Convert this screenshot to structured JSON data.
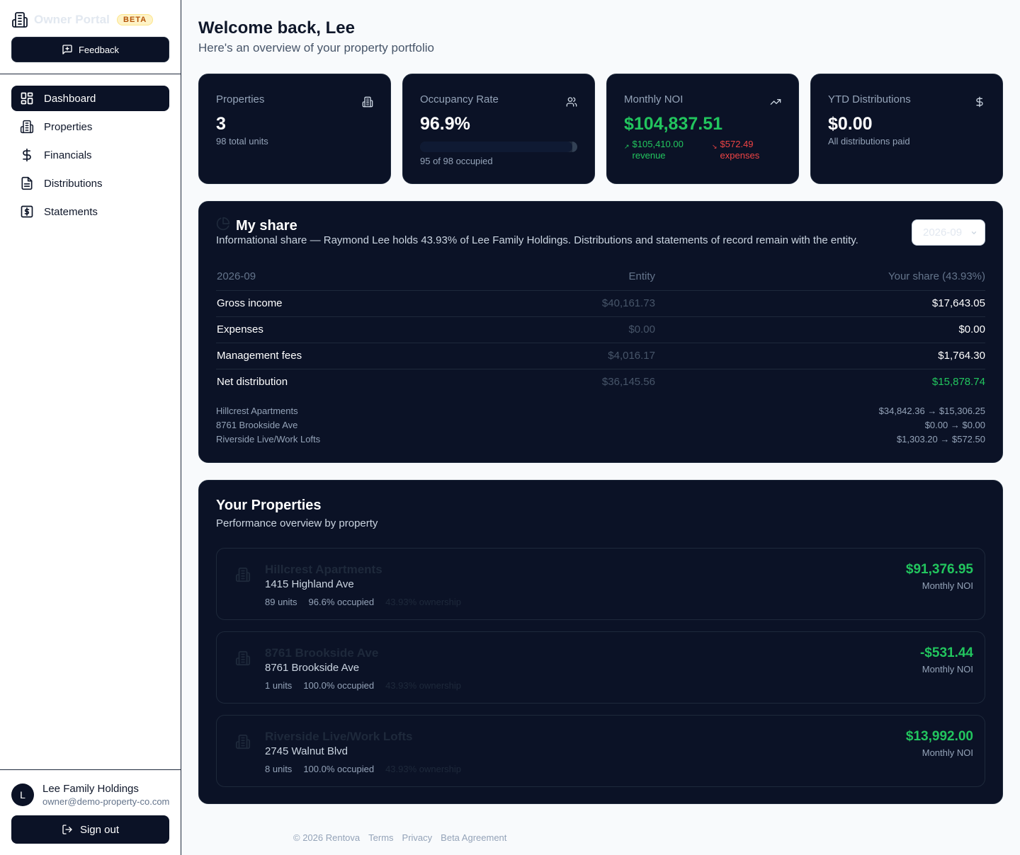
{
  "app": {
    "name": "Owner Portal",
    "badge": "BETA",
    "feedback_label": "Feedback"
  },
  "sidebar": {
    "items": [
      {
        "label": "Dashboard",
        "icon": "dashboard-icon",
        "active": true
      },
      {
        "label": "Properties",
        "icon": "building-icon"
      },
      {
        "label": "Financials",
        "icon": "dollar-icon"
      },
      {
        "label": "Distributions",
        "icon": "document-icon"
      },
      {
        "label": "Statements",
        "icon": "statement-icon"
      }
    ]
  },
  "user": {
    "initial": "L",
    "name": "Lee Family Holdings",
    "email": "owner@demo-property-co.com",
    "signout_label": "Sign out"
  },
  "header": {
    "title": "Welcome back, Lee",
    "subtitle": "Here's an overview of your property portfolio"
  },
  "stats": {
    "properties": {
      "label": "Properties",
      "value": "3",
      "note": "98 total units",
      "icon": "building-icon"
    },
    "occupancy": {
      "label": "Occupancy Rate",
      "value": "96.9%",
      "note": "95 of 98 occupied",
      "progress": 0.969,
      "icon": "users-icon"
    },
    "noi": {
      "label": "Monthly NOI",
      "value": "$104,837.51",
      "revenue": "$105,410.00",
      "revenue_suffix": "revenue",
      "expenses": "$572.49",
      "expenses_suffix": "expenses",
      "icon": "trending-up-icon"
    },
    "ytd": {
      "label": "YTD Distributions",
      "value": "$0.00",
      "note": "All distributions paid",
      "icon": "dollar-icon"
    }
  },
  "share": {
    "title": "My share",
    "description": "Informational share — Raymond Lee holds 43.93% of Lee Family Holdings. Distributions and statements of record remain with the entity.",
    "period": "2026-09",
    "headers": [
      "2026-09",
      "Entity",
      "Your share (43.93%)"
    ],
    "rows": [
      {
        "label": "Gross income",
        "entity": "$40,161.73",
        "share": "$17,643.05"
      },
      {
        "label": "Expenses",
        "entity": "$0.00",
        "share": "$0.00"
      },
      {
        "label": "Management fees",
        "entity": "$4,016.17",
        "share": "$1,764.30"
      },
      {
        "label": "Net distribution",
        "entity": "$36,145.56",
        "share": "$15,878.74"
      }
    ],
    "breakdown": [
      {
        "name": "Hillcrest Apartments",
        "value": "$34,842.36 → $15,306.25"
      },
      {
        "name": "8761 Brookside Ave",
        "value": "$0.00 → $0.00"
      },
      {
        "name": "Riverside Live/Work Lofts",
        "value": "$1,303.20 → $572.50"
      }
    ]
  },
  "properties": {
    "title": "Your Properties",
    "subtitle": "Performance overview by property",
    "noi_label": "Monthly NOI",
    "items": [
      {
        "name": "Hillcrest Apartments",
        "address": "1415 Highland Ave",
        "units": "89 units",
        "occupied": "96.6% occupied",
        "extra": "43.93% ownership",
        "noi": "$91,376.95"
      },
      {
        "name": "8761 Brookside Ave",
        "address": "8761 Brookside Ave",
        "units": "1 units",
        "occupied": "100.0% occupied",
        "extra": "43.93% ownership",
        "noi": "-$531.44"
      },
      {
        "name": "Riverside Live/Work Lofts",
        "address": "2745 Walnut Blvd",
        "units": "8 units",
        "occupied": "100.0% occupied",
        "extra": "43.93% ownership",
        "noi": "$13,992.00"
      }
    ]
  },
  "footer": {
    "copyright": "© 2026 Rentova",
    "links": [
      "Terms",
      "Privacy",
      "Beta Agreement"
    ]
  }
}
